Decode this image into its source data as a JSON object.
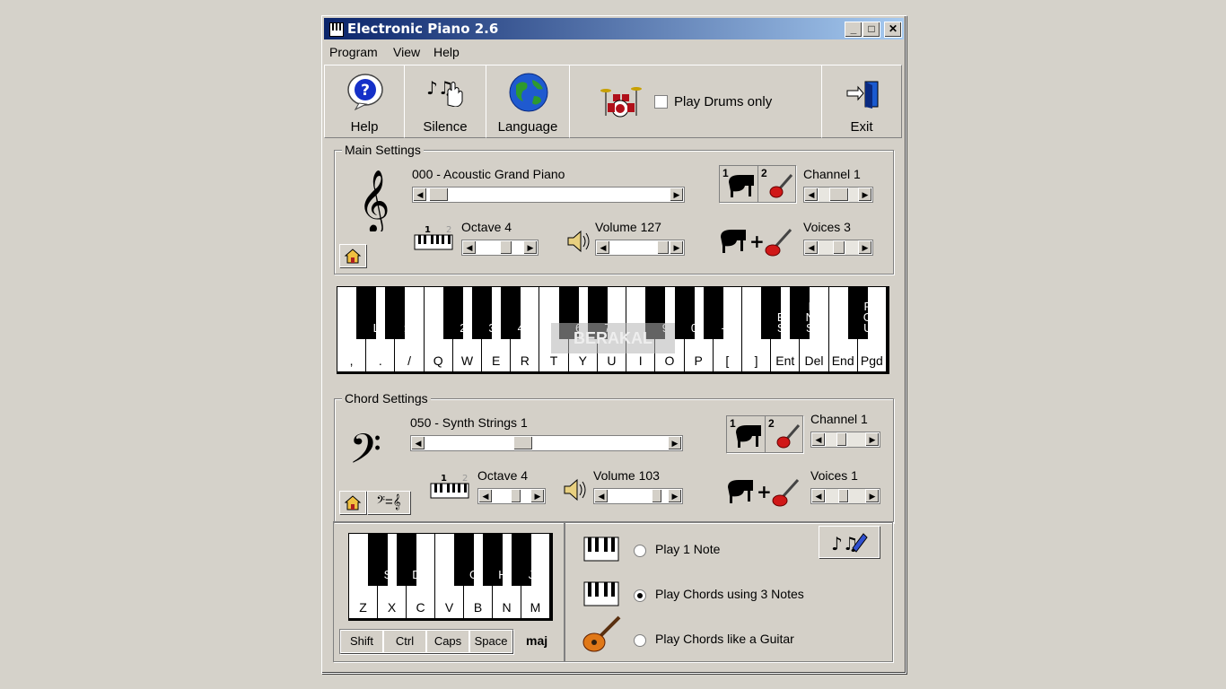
{
  "window": {
    "title": "Electronic Piano 2.6",
    "min": "_",
    "max": "□",
    "close": "✕"
  },
  "menu": [
    "Program",
    "View",
    "Help"
  ],
  "toolbar": {
    "help": "Help",
    "silence": "Silence",
    "language": "Language",
    "drums_label": "Play Drums only",
    "exit": "Exit"
  },
  "main": {
    "group": "Main Settings",
    "instrument": "000 - Acoustic Grand Piano",
    "instrument_pos": 0.0,
    "channel": "Channel 1",
    "octave": "Octave 4",
    "volume": "Volume 127",
    "voices": "Voices 3",
    "switch1": "1",
    "switch2": "2",
    "oct1": "1",
    "oct2": "2"
  },
  "main_keys": {
    "white": [
      ",",
      ".",
      "/",
      "Q",
      "W",
      "E",
      "R",
      "T",
      "Y",
      "U",
      "I",
      "O",
      "P",
      "[",
      "]",
      "Ent",
      "Del",
      "End",
      "Pgd"
    ],
    "black": [
      "L",
      ";",
      "2",
      "3",
      "4",
      "6",
      "7",
      "9",
      "0",
      "-",
      "B S",
      "I N S",
      "P G U"
    ]
  },
  "watermark": "BERAKAL",
  "chord": {
    "group": "Chord Settings",
    "instrument": "050 - Synth Strings 1",
    "instrument_pos": 0.4,
    "channel": "Channel 1",
    "octave": "Octave 4",
    "volume": "Volume 103",
    "voices": "Voices 1",
    "switch1": "1",
    "switch2": "2",
    "oct1": "1",
    "oct2": "2",
    "clef_btn": "𝄢=𝄞"
  },
  "chord_keys": {
    "white": [
      "Z",
      "X",
      "C",
      "V",
      "B",
      "N",
      "M"
    ],
    "black": [
      "S",
      "D",
      "G",
      "H",
      "J"
    ]
  },
  "modifiers": [
    "Shift",
    "Ctrl",
    "Caps",
    "Space"
  ],
  "chord_type": "maj",
  "play_modes": [
    {
      "label": "Play 1 Note",
      "selected": false
    },
    {
      "label": "Play Chords using 3 Notes",
      "selected": true
    },
    {
      "label": "Play Chords like a Guitar",
      "selected": false
    }
  ]
}
